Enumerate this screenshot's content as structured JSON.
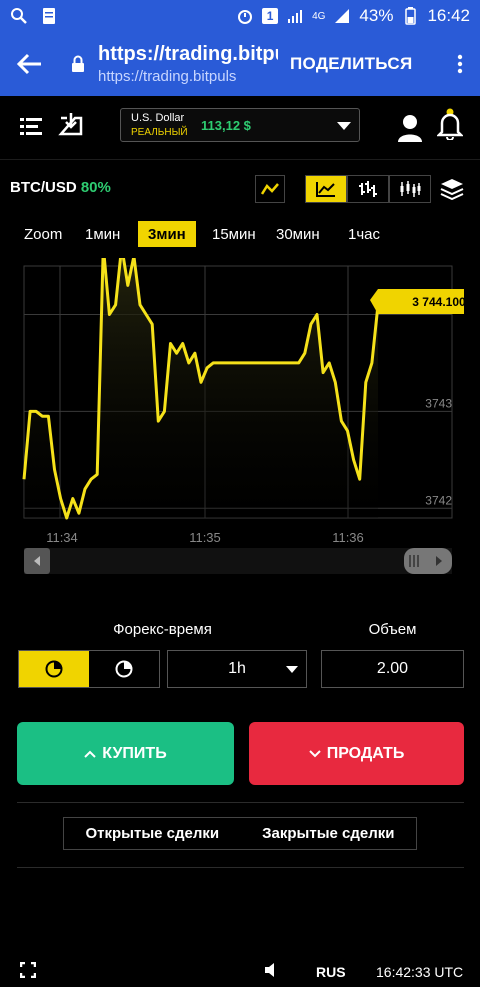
{
  "status_bar": {
    "battery_percent": "43%",
    "time": "16:42",
    "notification_badge": "1",
    "network": "4G"
  },
  "browser": {
    "url_main": "https://trading.bitpuls...",
    "url_sub": "https://trading.bitpuls",
    "share_label": "ПОДЕЛИТЬСЯ"
  },
  "account": {
    "currency": "U.S. Dollar",
    "type": "РЕАЛЬНЫЙ",
    "balance": "113,12 $"
  },
  "pair": {
    "name": "BTC/USD",
    "payout": "80%"
  },
  "timeframes": {
    "zoom": "Zoom",
    "items": [
      "1мин",
      "3мин",
      "15мин",
      "30мин",
      "1час"
    ],
    "active": "3мин"
  },
  "chart_data": {
    "type": "line",
    "current_price_label": "3 744.100",
    "y_tick_labels": [
      "3743",
      "3742"
    ],
    "x_tick_labels": [
      "11:34",
      "11:35",
      "11:36"
    ],
    "series": [
      {
        "x": [
          0,
          1,
          2,
          3,
          4,
          5,
          6,
          7,
          8,
          9,
          10,
          11,
          12,
          13,
          14,
          15,
          16,
          17,
          18,
          19,
          20,
          21,
          22,
          23,
          24,
          25,
          26,
          27,
          28,
          29,
          30,
          31,
          32,
          33,
          34,
          35,
          36,
          37,
          38,
          39,
          40,
          41,
          42,
          43,
          44,
          45,
          46,
          47,
          48,
          49,
          50,
          51,
          52,
          53,
          54,
          55,
          56,
          57,
          58
        ],
        "values": [
          3742.3,
          3743.0,
          3743.0,
          3742.95,
          3742.95,
          3742.4,
          3742.1,
          3741.9,
          3742.1,
          3741.95,
          3742.2,
          3742.3,
          3742.35,
          3745.0,
          3744.0,
          3744.1,
          3746.0,
          3744.3,
          3744.6,
          3744.1,
          3744.0,
          3743.9,
          3742.9,
          3743.0,
          3743.7,
          3743.6,
          3743.7,
          3743.5,
          3743.6,
          3743.3,
          3743.45,
          3743.5,
          3743.5,
          3743.5,
          3743.5,
          3743.5,
          3743.5,
          3743.5,
          3743.5,
          3743.5,
          3743.5,
          3743.5,
          3743.5,
          3743.5,
          3743.5,
          3743.5,
          3743.6,
          3743.9,
          3744.0,
          3743.4,
          3743.5,
          3743.3,
          3742.9,
          3742.8,
          3742.5,
          3742.3,
          3743.3,
          3743.5,
          3744.1
        ]
      }
    ],
    "ylim": [
      3741.9,
      3744.5
    ],
    "grid": true,
    "line_color": "#f5e11a"
  },
  "controls": {
    "forex_time_label": "Форекс-время",
    "volume_label": "Объем",
    "expiry_value": "1h",
    "volume_value": "2.00",
    "buy_label": "КУПИТЬ",
    "sell_label": "ПРОДАТЬ",
    "open_deals": "Открытые сделки",
    "closed_deals": "Закрытые сделки"
  },
  "bottom_bar": {
    "language": "RUS",
    "time": "16:42:33 UTC"
  },
  "colors": {
    "accent": "#f0d400",
    "buy": "#1bbf84",
    "sell": "#e8293f",
    "browser": "#2a5bd7",
    "positive": "#2ecc71"
  }
}
